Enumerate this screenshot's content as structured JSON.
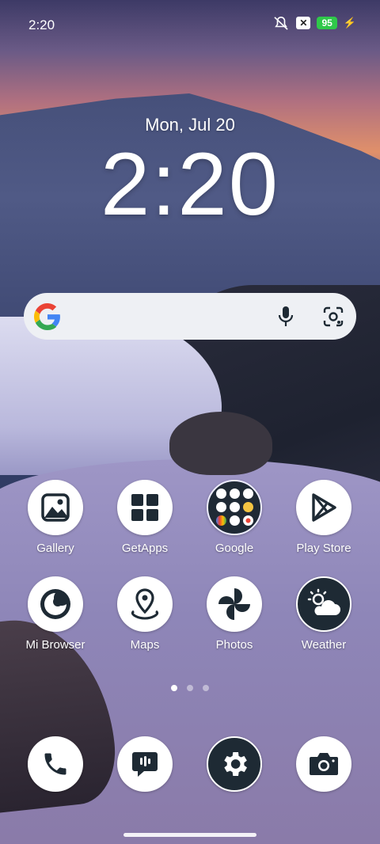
{
  "status": {
    "time": "2:20",
    "battery": "95",
    "icons": [
      "silent-icon",
      "x-notification-icon",
      "battery-icon",
      "charging-icon"
    ]
  },
  "clock": {
    "date": "Mon, Jul 20",
    "time": "2:20"
  },
  "search": {
    "icons": [
      "google-logo",
      "mic-icon",
      "lens-icon"
    ]
  },
  "apps": [
    {
      "label": "Gallery",
      "icon": "gallery-icon"
    },
    {
      "label": "GetApps",
      "icon": "getapps-icon"
    },
    {
      "label": "Google",
      "icon": "google-folder-icon"
    },
    {
      "label": "Play Store",
      "icon": "play-store-icon"
    },
    {
      "label": "Mi Browser",
      "icon": "mi-browser-icon"
    },
    {
      "label": "Maps",
      "icon": "maps-icon"
    },
    {
      "label": "Photos",
      "icon": "photos-icon"
    },
    {
      "label": "Weather",
      "icon": "weather-icon"
    }
  ],
  "dock": [
    "phone-icon",
    "messages-icon",
    "settings-icon",
    "camera-icon"
  ],
  "pages": {
    "count": 3,
    "active": 1
  },
  "colors": {
    "icon_fg": "#1e2a34",
    "battery": "#2fc84a"
  }
}
